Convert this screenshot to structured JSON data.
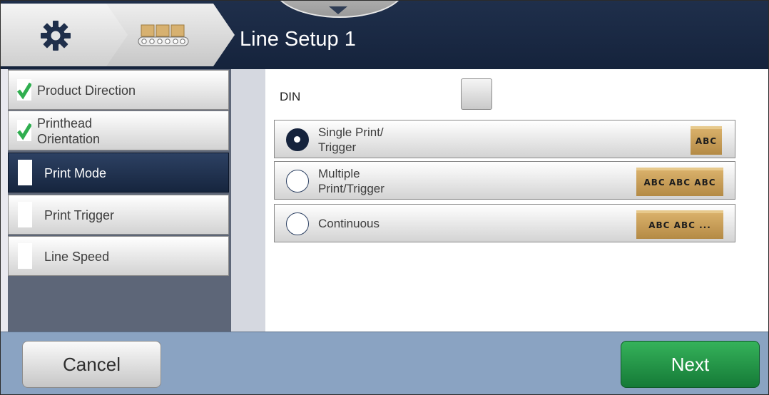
{
  "header": {
    "title": "Line Setup 1",
    "crumbs": [
      {
        "icon": "gear-icon"
      },
      {
        "icon": "conveyor-icon"
      }
    ],
    "top_tab_icon": "chevron-down-icon"
  },
  "sidebar": {
    "items": [
      {
        "label": "Product Direction",
        "completed": true,
        "active": false
      },
      {
        "label": "Printhead\nOrientation",
        "completed": true,
        "active": false
      },
      {
        "label": "Print Mode",
        "completed": false,
        "active": true
      },
      {
        "label": "Print Trigger",
        "completed": false,
        "active": false
      },
      {
        "label": "Line Speed",
        "completed": false,
        "active": false
      }
    ]
  },
  "content": {
    "din_label": "DIN",
    "din_checked": false,
    "options": [
      {
        "label": "Single Print/\nTrigger",
        "selected": true,
        "image_text": "ABC"
      },
      {
        "label": "Multiple\nPrint/Trigger",
        "selected": false,
        "image_text": "ABC ABC ABC"
      },
      {
        "label": "Continuous",
        "selected": false,
        "image_text": "ABC ABC ..."
      }
    ]
  },
  "footer": {
    "cancel_label": "Cancel",
    "next_label": "Next"
  },
  "colors": {
    "header": "#15233c",
    "active_nav": "#1f2f4b",
    "check": "#2fae4f",
    "next": "#1f9141",
    "footer": "#8aa3c2"
  }
}
